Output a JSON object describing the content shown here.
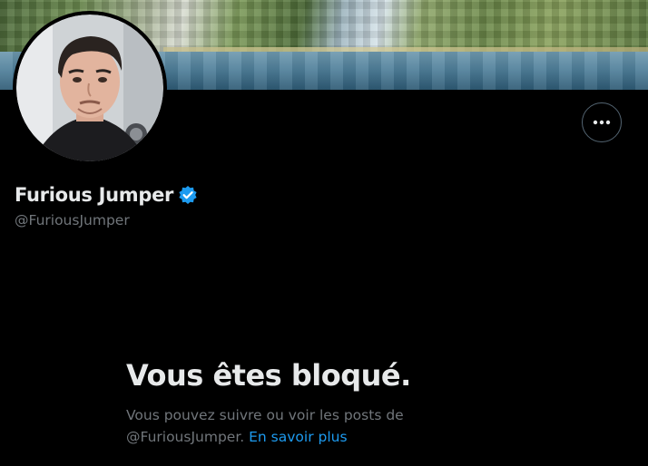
{
  "profile": {
    "display_name": "Furious Jumper",
    "handle": "@FuriousJumper",
    "verified_icon": "verified-badge-icon",
    "avatar_icon": "profile-avatar"
  },
  "actions": {
    "more_icon": "more-horizontal-icon"
  },
  "blocked": {
    "title": "Vous êtes bloqué.",
    "description_prefix": "Vous pouvez suivre ou voir les posts de ",
    "description_handle": "@FuriousJumper.",
    "learn_more_label": "En savoir plus"
  },
  "colors": {
    "background": "#000000",
    "primary_text": "#e7e9ea",
    "secondary_text": "#71767b",
    "link": "#1d9bf0",
    "verified": "#1d9bf0",
    "border": "#536471"
  }
}
